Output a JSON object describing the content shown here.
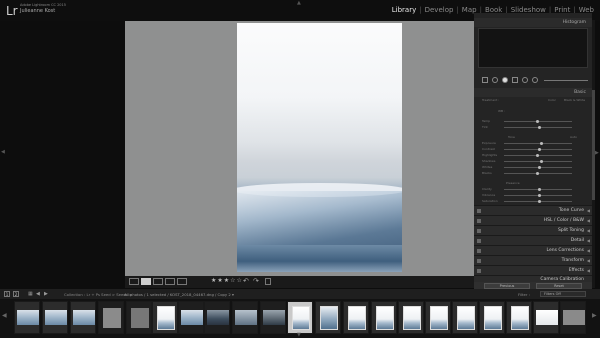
{
  "app": {
    "logo": "Lr",
    "catalog_line": "Adobe Lightroom CC 2015",
    "user_name": "Julieanne Kost"
  },
  "modules": [
    {
      "label": "Library",
      "active": true
    },
    {
      "label": "Develop",
      "active": false
    },
    {
      "label": "Map",
      "active": false
    },
    {
      "label": "Book",
      "active": false
    },
    {
      "label": "Slideshow",
      "active": false
    },
    {
      "label": "Print",
      "active": false
    },
    {
      "label": "Web",
      "active": false
    }
  ],
  "module_separator": "|",
  "right_panel": {
    "histogram_label": "Histogram",
    "basic_label": "Basic",
    "basic_sub_labels": {
      "treatment": "Treatment :",
      "color": "Color",
      "bw": "Black & White",
      "wb": "WB :",
      "temp": "Temp",
      "tint": "Tint",
      "tone": "Tone",
      "auto": "Auto",
      "exposure": "Exposure",
      "contrast": "Contrast",
      "highlights": "Highlights",
      "shadows": "Shadows",
      "whites": "Whites",
      "blacks": "Blacks",
      "presence": "Presence",
      "clarity": "Clarity",
      "vibrance": "Vibrance",
      "saturation": "Saturation"
    },
    "sections": [
      "Tone Curve",
      "HSL / Color / B&W",
      "Split Toning",
      "Detail",
      "Lens Corrections",
      "Transform",
      "Effects",
      "Camera Calibration"
    ],
    "buttons": {
      "previous": "Previous",
      "reset": "Reset"
    }
  },
  "toolbar": {
    "stars": "★★★☆☆"
  },
  "filmstrip_header": {
    "view_numbers": [
      "1",
      "2"
    ],
    "source": "Collection : Lr + Ps Seed > Seeds >",
    "count": "All photos / 1 selected / KOST_2018_04467.dng / Copy 2 ▾",
    "filter_label": "Filter :",
    "filter_value": "Filters Off"
  },
  "icons": {
    "grid": "grid-view-icon",
    "loupe": "loupe-view-icon",
    "compare": "compare-view-icon",
    "survey": "survey-view-icon",
    "rotate_left": "rotate-left-icon",
    "rotate_right": "rotate-right-icon"
  }
}
